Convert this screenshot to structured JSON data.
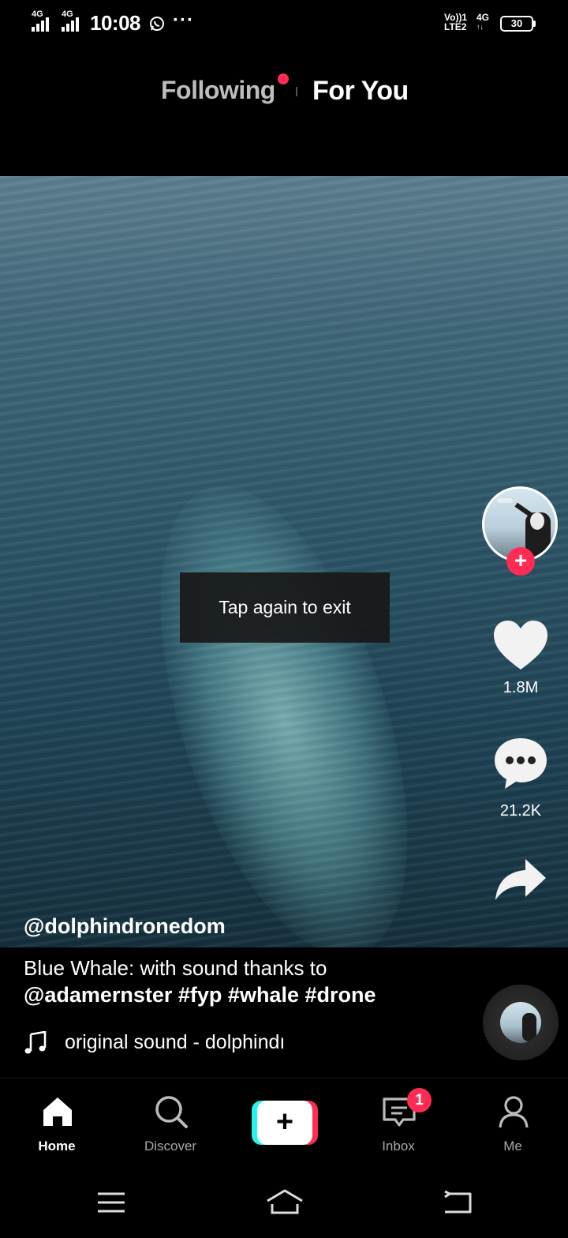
{
  "status_bar": {
    "sim1_label": "4G",
    "sim2_label": "4G",
    "time": "10:08",
    "overflow": "···",
    "volte_line1": "Vo))1",
    "volte_line2": "LTE2",
    "net_label_1": "4G",
    "net_label_2": "↑↓",
    "battery": "30",
    "icons": [
      "signal-icon",
      "signal-icon",
      "whatsapp-icon",
      "battery-icon"
    ]
  },
  "top_tabs": {
    "following": "Following",
    "for_you": "For You",
    "active": "For You"
  },
  "toast": {
    "text": "Tap again to exit"
  },
  "actions": {
    "likes": "1.8M",
    "comments": "21.2K",
    "follow_symbol": "+"
  },
  "post": {
    "username": "@dolphindronedom",
    "caption_line1": "Blue Whale: with sound thanks to",
    "caption_line2": "@adamernster #fyp #whale #drone",
    "sound": "original sound - dolphindı"
  },
  "bottom_nav": {
    "home": "Home",
    "discover": "Discover",
    "create_symbol": "+",
    "inbox": "Inbox",
    "inbox_badge": "1",
    "me": "Me"
  },
  "colors": {
    "accent": "#fe2c55",
    "cyan": "#25f4ee",
    "background": "#000000"
  }
}
